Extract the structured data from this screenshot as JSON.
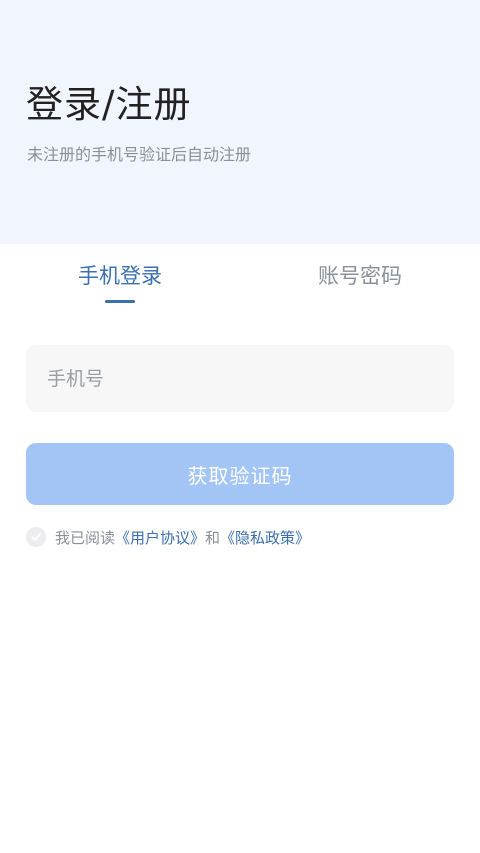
{
  "header": {
    "title": "登录/注册",
    "subtitle": "未注册的手机号验证后自动注册"
  },
  "tabs": [
    {
      "label": "手机登录",
      "active": true
    },
    {
      "label": "账号密码",
      "active": false
    }
  ],
  "form": {
    "phone_value": "",
    "phone_placeholder": "手机号",
    "submit_label": "获取验证码"
  },
  "agreement": {
    "checked": false,
    "prefix": "我已阅读",
    "user_agreement": "《用户协议》",
    "conjunction": "和",
    "privacy_policy": "《隐私政策》"
  },
  "colors": {
    "hero_background": "#f1f5fe",
    "accent": "#3a6fb0",
    "button_disabled": "#a3c5f6",
    "input_background": "#f7f7f8",
    "muted_text": "#8a8f99"
  },
  "icons": {
    "agreement_checkbox": "check-icon"
  }
}
